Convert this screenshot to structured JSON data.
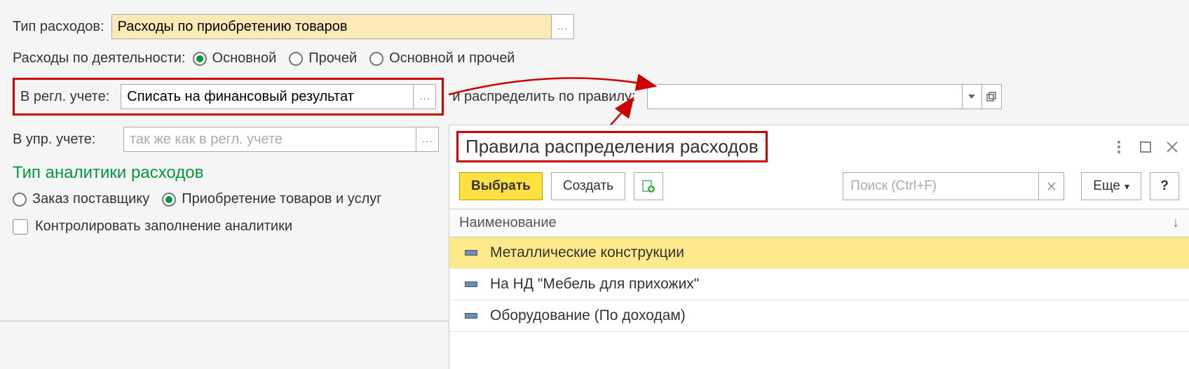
{
  "labels": {
    "expense_type": "Тип расходов:",
    "activity": "Расходы по деятельности:",
    "regl": "В регл. учете:",
    "rule_label": "и распределить по правилу:",
    "upr": "В упр. учете:",
    "analytics_title": "Тип аналитики расходов",
    "control_fill": "Контролировать заполнение аналитики"
  },
  "expense_type_value": "Расходы по приобретению товаров",
  "activity_options": {
    "main": "Основной",
    "other": "Прочей",
    "both": "Основной и прочей"
  },
  "regl_value": "Списать на финансовый результат",
  "upr_placeholder": "так же как в регл. учете",
  "rule_value": "",
  "analytics_options": {
    "order": "Заказ поставщику",
    "purchase": "Приобретение товаров и услуг"
  },
  "dialog": {
    "title": "Правила распределения расходов",
    "select_btn": "Выбрать",
    "create_btn": "Создать",
    "search_placeholder": "Поиск (Ctrl+F)",
    "more_btn": "Еще",
    "help_btn": "?",
    "col_name": "Наименование",
    "items": [
      "Металлические конструкции",
      "На НД \"Мебель для прихожих\"",
      "Оборудование (По доходам)"
    ]
  }
}
